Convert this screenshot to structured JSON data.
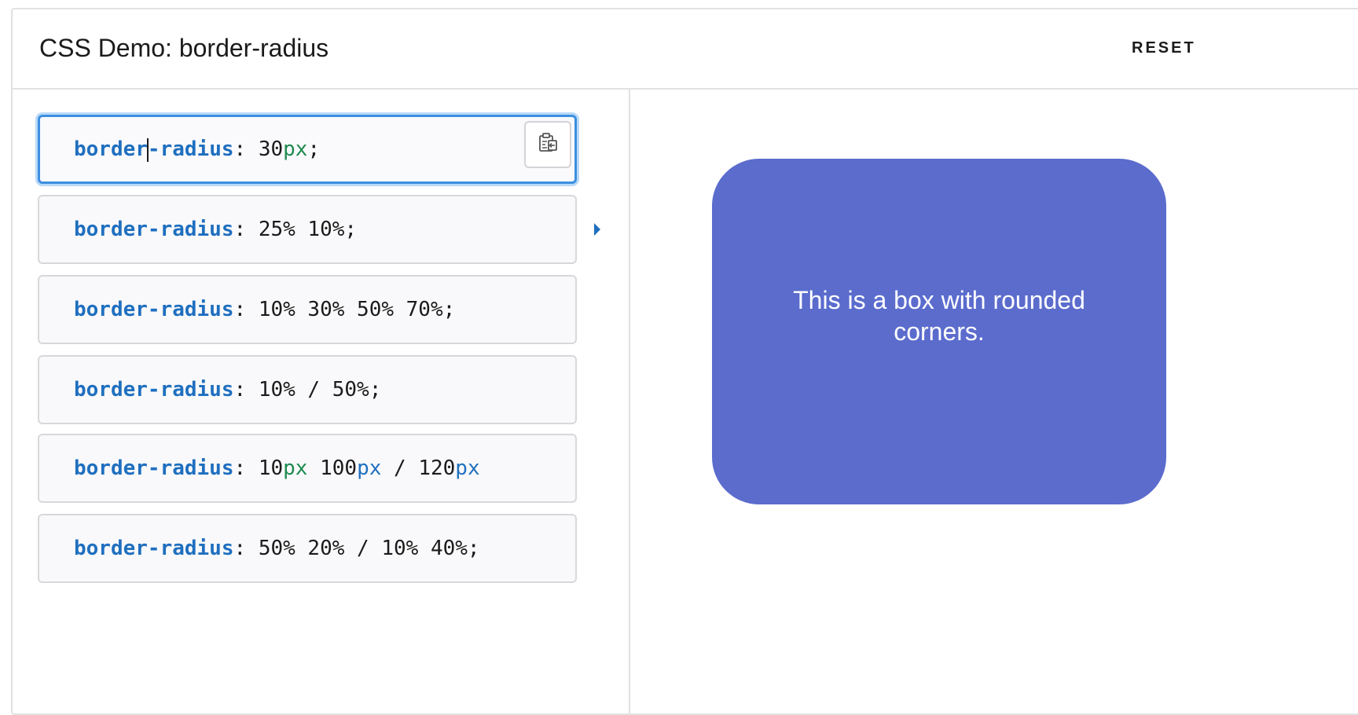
{
  "header": {
    "title": "CSS Demo: border-radius",
    "reset_label": "RESET"
  },
  "editor": {
    "choices": [
      {
        "prop": "border-radius",
        "sep": ": ",
        "parts": [
          "30",
          "px",
          ";"
        ],
        "selected": true
      },
      {
        "prop": "border-radius",
        "sep": ": ",
        "value": "25% 10%;"
      },
      {
        "prop": "border-radius",
        "sep": ": ",
        "value": "10% 30% 50% 70%;"
      },
      {
        "prop": "border-radius",
        "sep": ": ",
        "value": "10% / 50%;"
      },
      {
        "prop": "border-radius",
        "sep": ": ",
        "parts": [
          "10",
          "px",
          " 100",
          "px",
          " / 120",
          "px"
        ]
      },
      {
        "prop": "border-radius",
        "sep": ": ",
        "value": "50% 20% / 10% 40%;"
      }
    ],
    "copy_icon": "clipboard-copy-icon"
  },
  "output": {
    "box_text": "This is a box with rounded corners.",
    "box_color": "#5b6ccd"
  },
  "colors": {
    "property": "#1f6fbf",
    "unit": "#1c8a4f",
    "selected_border": "#3d8fe0"
  }
}
